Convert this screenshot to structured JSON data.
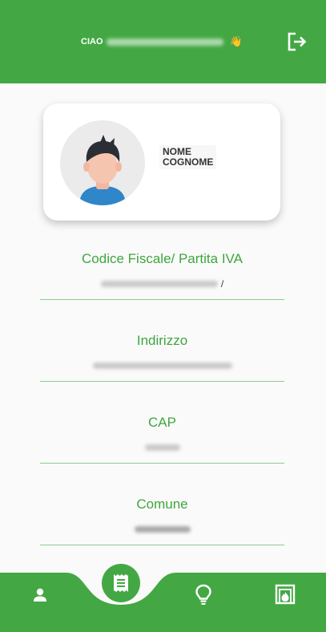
{
  "header": {
    "greeting": "CIAO",
    "wave_emoji": "👋"
  },
  "colors": {
    "primary": "#43a843",
    "accent_text": "#3fa63f",
    "divider": "#8fcc8f",
    "background": "#fafafa"
  },
  "profile": {
    "name_line1": "NOME",
    "name_line2": "COGNOME"
  },
  "fields": [
    {
      "label": "Codice Fiscale/ Partita IVA",
      "suffix": "/"
    },
    {
      "label": "Indirizzo"
    },
    {
      "label": "CAP"
    },
    {
      "label": "Comune"
    }
  ],
  "nav": {
    "items": [
      {
        "icon": "person-icon"
      },
      {
        "icon": "receipt-icon",
        "active": true
      },
      {
        "icon": "lightbulb-icon"
      },
      {
        "icon": "fireplace-icon"
      }
    ]
  },
  "icons": {
    "logout": "logout-icon"
  }
}
